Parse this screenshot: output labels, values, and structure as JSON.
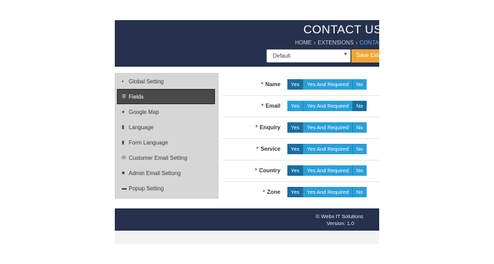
{
  "header": {
    "title": "CONTACT US",
    "breadcrumbs": [
      "HOME",
      "EXTENSIONS",
      "CONTACT"
    ],
    "store_select": "Default",
    "save_label": "Save Exten"
  },
  "sidebar": {
    "items": [
      {
        "label": "Global Setting",
        "icon": "dashboard-icon"
      },
      {
        "label": "Fields",
        "icon": "list-icon",
        "active": true
      },
      {
        "label": "Google Map",
        "icon": "map-marker-icon"
      },
      {
        "label": "Language",
        "icon": "language-icon"
      },
      {
        "label": "Form Language",
        "icon": "language-icon"
      },
      {
        "label": "Customer Email Setting",
        "icon": "envelope-icon"
      },
      {
        "label": "Admin Email Settong",
        "icon": "lock-icon"
      },
      {
        "label": "Popup Setting",
        "icon": "folder-icon"
      }
    ]
  },
  "fields": {
    "options": [
      "Yes",
      "Yes And Required",
      "No"
    ],
    "rows": [
      {
        "label": "Name",
        "selected": "Yes"
      },
      {
        "label": "Email",
        "selected": "No"
      },
      {
        "label": "Enquiry",
        "selected": "Yes"
      },
      {
        "label": "Service",
        "selected": "Yes"
      },
      {
        "label": "Country",
        "selected": "Yes"
      },
      {
        "label": "Zone",
        "selected": "Yes"
      }
    ],
    "required_mark": "*"
  },
  "footer": {
    "company": "© Webx IT Solutions",
    "version": "Version: 1.0"
  },
  "colors": {
    "header_bg": "#26314d",
    "accent_blue": "#2a9fd8",
    "selected_blue": "#1a6ea0",
    "save_orange": "#f0a634",
    "required_red": "#d9251d"
  }
}
